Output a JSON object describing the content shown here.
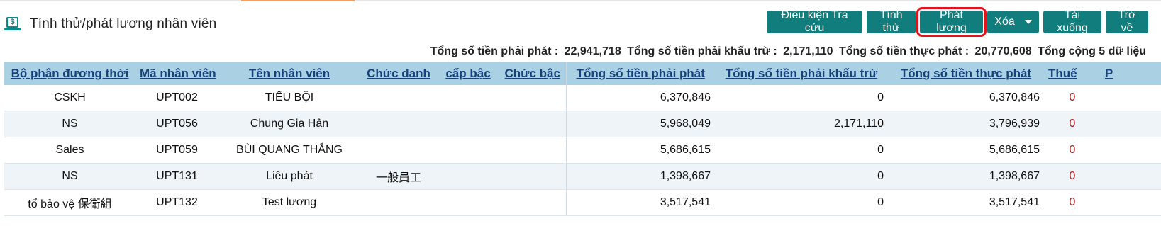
{
  "page": {
    "title": "Tính thử/phát lương nhân viên",
    "icon": "money-icon"
  },
  "toolbar": {
    "query_label": "Điều kiện Tra cứu",
    "trial_label": "Tính thử",
    "pay_label": "Phát lương",
    "delete_label": "Xóa",
    "download_label": "Tải xuống",
    "back_label": "Trở về"
  },
  "summary": {
    "payable_label": "Tổng số tiền phải phát :",
    "payable_value": "22,941,718",
    "deduct_label": "Tổng số tiền phải khấu trừ :",
    "deduct_value": "2,171,110",
    "actual_label": "Tổng số tiền thực phát :",
    "actual_value": "20,770,608",
    "count_text": "Tổng cộng 5 dữ liệu"
  },
  "table": {
    "headers": [
      "Bộ phận đương thời",
      "Mã nhân viên",
      "Tên nhân viên",
      "Chức danh",
      "cấp bậc",
      "Chức bậc",
      "Tổng số tiền phải phát",
      "Tổng số tiền phải khấu trừ",
      "Tổng số tiền thực phát",
      "Thuế",
      "P"
    ],
    "rows": [
      [
        "CSKH",
        "UPT002",
        "TIỂU BỘI",
        "",
        "",
        "",
        "6,370,846",
        "0",
        "6,370,846",
        "0"
      ],
      [
        "NS",
        "UPT056",
        "Chung Gia Hân",
        "",
        "",
        "",
        "5,968,049",
        "2,171,110",
        "3,796,939",
        "0"
      ],
      [
        "Sales",
        "UPT059",
        "BÙI QUANG THẮNG",
        "",
        "",
        "",
        "5,686,615",
        "0",
        "5,686,615",
        "0"
      ],
      [
        "NS",
        "UPT131",
        "Liêu phát",
        "一般員工",
        "",
        "",
        "1,398,667",
        "0",
        "1,398,667",
        "0"
      ],
      [
        "tổ bảo vệ 保衛組",
        "UPT132",
        "Test lương",
        "",
        "",
        "",
        "3,517,541",
        "0",
        "3,517,541",
        "0"
      ]
    ]
  },
  "colors": {
    "button": "#127d7d",
    "header_bg": "#aad1e3",
    "header_text": "#17417a",
    "highlight": "#e4141e"
  }
}
